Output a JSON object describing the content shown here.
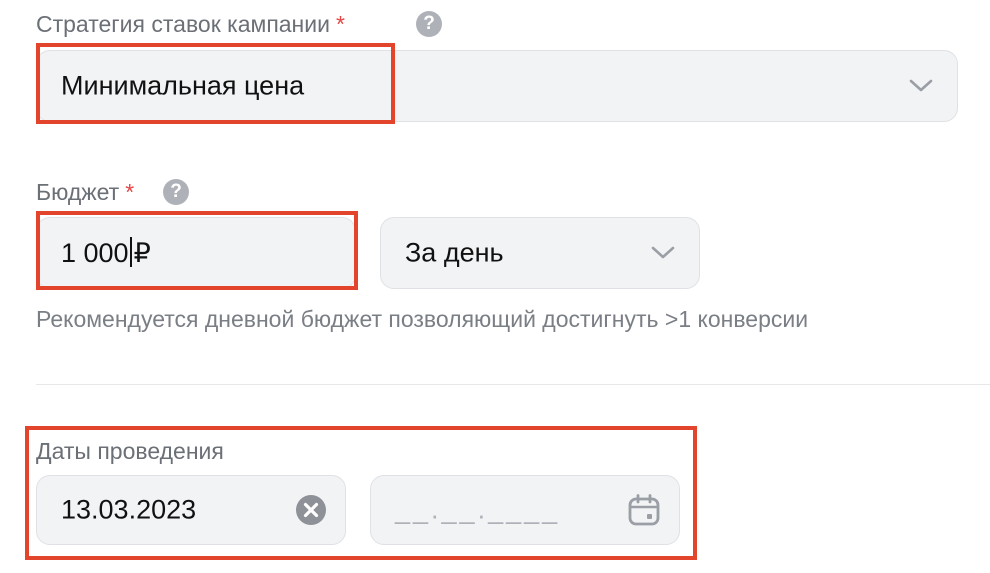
{
  "strategy": {
    "label": "Стратегия ставок кампании",
    "required_mark": "*",
    "help_glyph": "?",
    "value": "Минимальная цена"
  },
  "budget": {
    "label": "Бюджет",
    "required_mark": "*",
    "help_glyph": "?",
    "amount": "1 000",
    "currency": "₽",
    "period": "За день",
    "hint": "Рекомендуется дневной бюджет позволяющий достигнуть >1 конверсии"
  },
  "dates": {
    "label": "Даты проведения",
    "start": "13.03.2023",
    "end_placeholder": "__.__.____"
  },
  "colors": {
    "highlight": "#e2452b",
    "required": "#e64646",
    "field_bg": "#f2f3f5"
  }
}
